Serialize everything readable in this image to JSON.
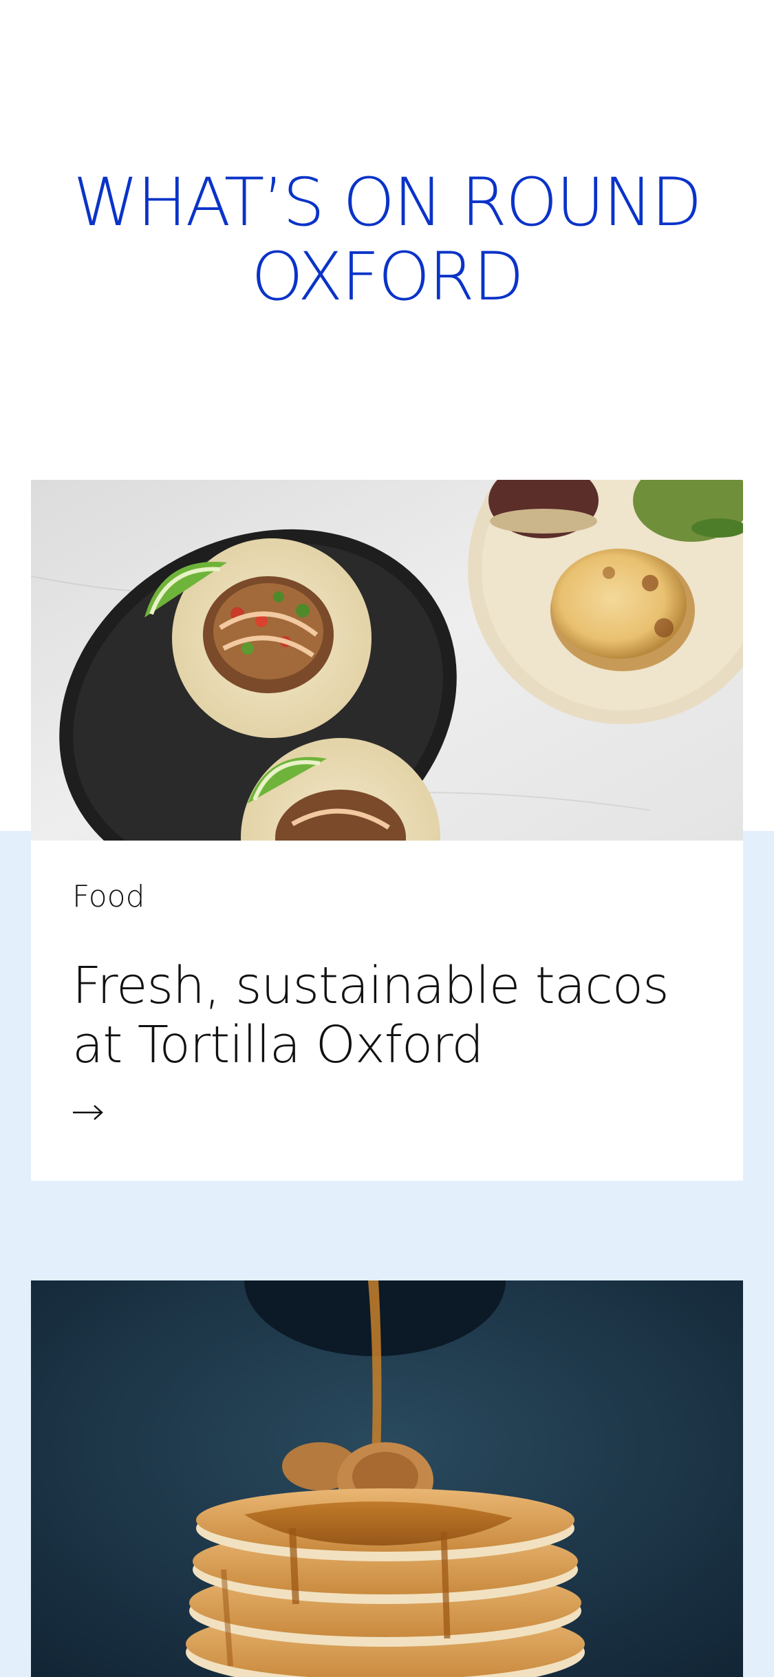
{
  "header": {
    "title_line1": "WHAT’S ON ROUND",
    "title_line2": "OXFORD"
  },
  "cards": [
    {
      "category": "Food",
      "title": "Fresh, sustainable tacos at Tortilla Oxford",
      "image_icon": "tacos-photo",
      "link_icon": "arrow-right-icon"
    },
    {
      "image_icon": "pancakes-photo"
    }
  ],
  "colors": {
    "accent": "#0a33c8",
    "section_bg": "#e3f0fc",
    "text": "#111111"
  }
}
